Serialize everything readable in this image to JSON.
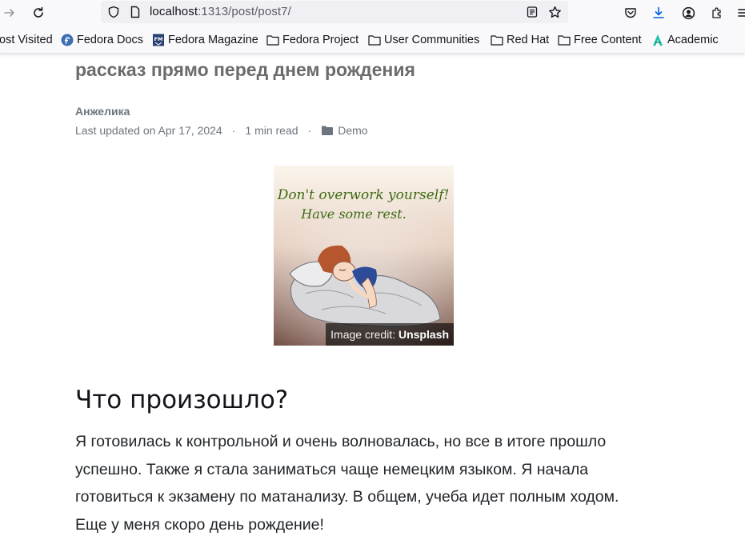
{
  "browser": {
    "url_host": "localhost",
    "url_rest": ":1313/post/post7/",
    "colors": {
      "download_icon": "#0061e0",
      "bar_bg": "#f9f9fb",
      "url_bg": "#f0f0f4"
    },
    "toolbar_icons": [
      "forward-icon",
      "reload-icon",
      "shield-icon",
      "page-icon",
      "reader-view-icon",
      "bookmark-star-icon",
      "pocket-icon",
      "download-icon",
      "account-icon",
      "extensions-icon",
      "menu-icon"
    ]
  },
  "bookmarks": [
    {
      "label": "ost Visited",
      "icon": "none"
    },
    {
      "label": "Fedora Docs",
      "icon": "fedora-icon"
    },
    {
      "label": "Fedora Magazine",
      "icon": "fedora-magazine-icon"
    },
    {
      "label": "Fedora Project",
      "icon": "folder-icon"
    },
    {
      "label": "User Communities",
      "icon": "folder-icon"
    },
    {
      "label": "Red Hat",
      "icon": "folder-icon"
    },
    {
      "label": "Free Content",
      "icon": "folder-icon"
    },
    {
      "label": "Academic",
      "icon": "academic-icon"
    }
  ],
  "post": {
    "title": "рассказ прямо перед днем рождения",
    "author": "Анжелика",
    "updated": "Last updated on Apr 17, 2024",
    "sep1": "·",
    "read_time": "1 min read",
    "sep2": "·",
    "category": "Demo"
  },
  "figure": {
    "line1": "Don't overwork yourself!",
    "line2": "Have some rest.",
    "credit_label": "Image credit: ",
    "credit_source": "Unsplash"
  },
  "section": {
    "heading": "Что произошло?",
    "paragraph": "Я готовилась к контрольной и очень волновалась, но все в итоге прошло успешно. Также я стала заниматься чаще немецким языком. Я начала готовиться к экзамену по матанализу. В общем, учеба идет полным ходом. Еще у меня скоро день рождение!"
  }
}
